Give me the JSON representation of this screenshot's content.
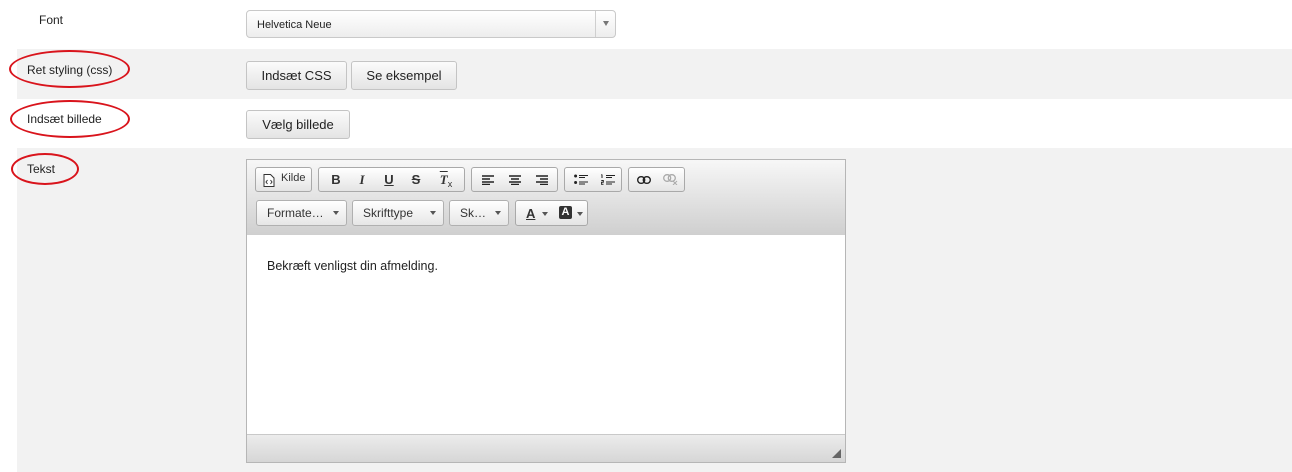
{
  "font_row": {
    "label": "Font",
    "select_value": "Helvetica Neue"
  },
  "css_row": {
    "label": "Ret styling (css)",
    "insert_css_label": "Indsæt CSS",
    "preview_label": "Se eksempel"
  },
  "image_row": {
    "label": "Indsæt billede",
    "choose_image_label": "Vælg billede"
  },
  "text_row": {
    "label": "Tekst"
  },
  "editor": {
    "source_label": "Kilde",
    "bold": "B",
    "italic": "I",
    "underline": "U",
    "strike": "S",
    "remove_format": "T",
    "remove_format_sub": "x",
    "format_combo": "Formate…",
    "font_combo": "Skrifttype",
    "size_combo": "Sk…",
    "text_color": "A",
    "bg_color": "A",
    "content": "Bekræft venligst din afmelding."
  },
  "colors": {
    "annotation": "#d9141c",
    "toolbar_top": "#f7f7f7",
    "toolbar_bottom": "#cfcfcf",
    "row_alt": "#f2f2f2"
  }
}
